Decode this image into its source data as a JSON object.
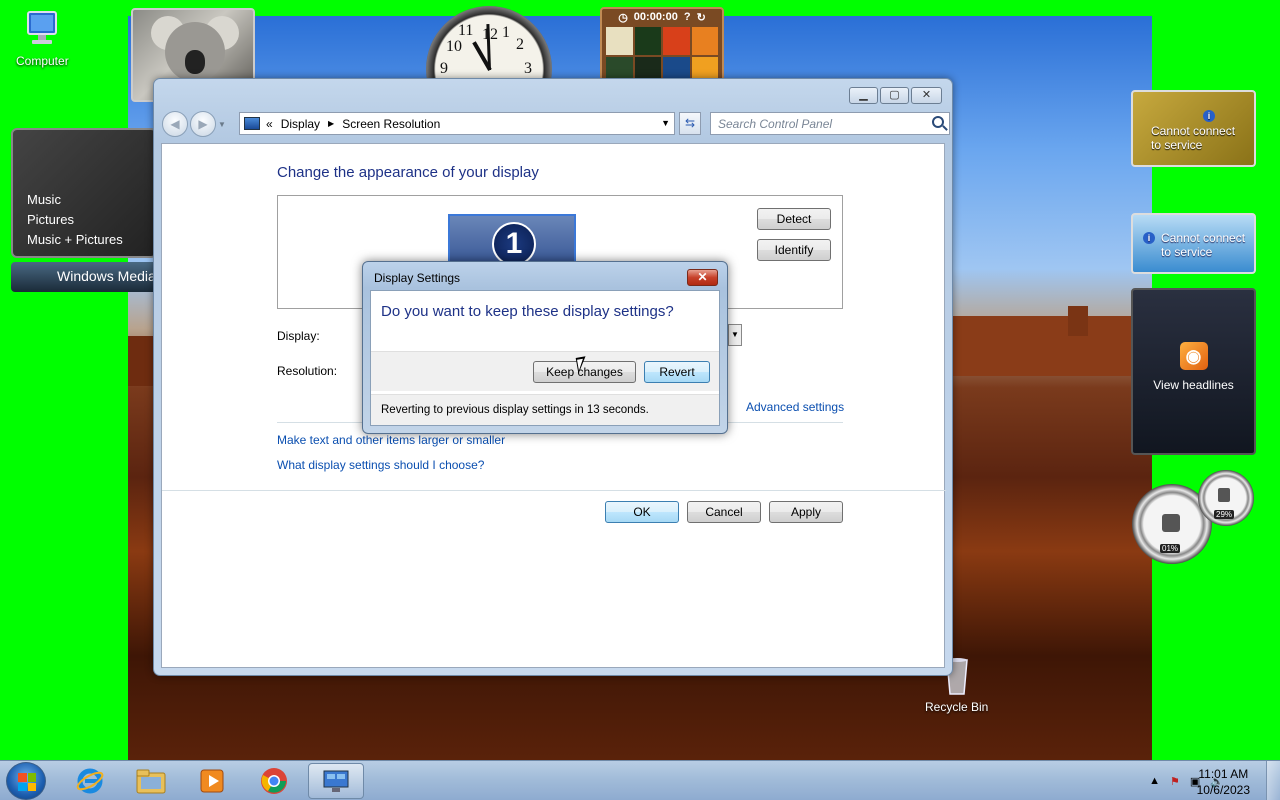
{
  "desktop": {
    "icons": {
      "computer": "Computer",
      "recycle_bin": "Recycle Bin"
    }
  },
  "gadgets": {
    "puzzle_timer": "00:00:00",
    "media_center": {
      "items": [
        "Music",
        "Pictures",
        "Music + Pictures"
      ],
      "bar_label": "Windows Media"
    },
    "weather_top": "Cannot connect to service",
    "weather_bottom": "Cannot connect to service",
    "feeds_label": "View headlines",
    "cpu_meter": {
      "cpu_percent": "01%",
      "memory_percent": "29%"
    }
  },
  "window": {
    "breadcrumb": {
      "prefix": "«",
      "items": [
        "Display",
        "Screen Resolution"
      ]
    },
    "search_placeholder": "Search Control Panel",
    "heading": "Change the appearance of your display",
    "monitor_number": "1",
    "detect_label": "Detect",
    "identify_label": "Identify",
    "display_label": "Display:",
    "resolution_label": "Resolution:",
    "advanced_link": "Advanced settings",
    "link_text_size": "Make text and other items larger or smaller",
    "link_which_settings": "What display settings should I choose?",
    "ok_label": "OK",
    "cancel_label": "Cancel",
    "apply_label": "Apply"
  },
  "dialog": {
    "title": "Display Settings",
    "question": "Do you want to keep these display settings?",
    "keep_label": "Keep changes",
    "revert_label": "Revert",
    "countdown": "Reverting to previous display settings in 13 seconds."
  },
  "taskbar": {
    "time": "11:01 AM",
    "date": "10/6/2023"
  },
  "colors": {
    "heading": "#1e3287",
    "link": "#0b4fb0",
    "desktop_bg": "#00ff00"
  }
}
